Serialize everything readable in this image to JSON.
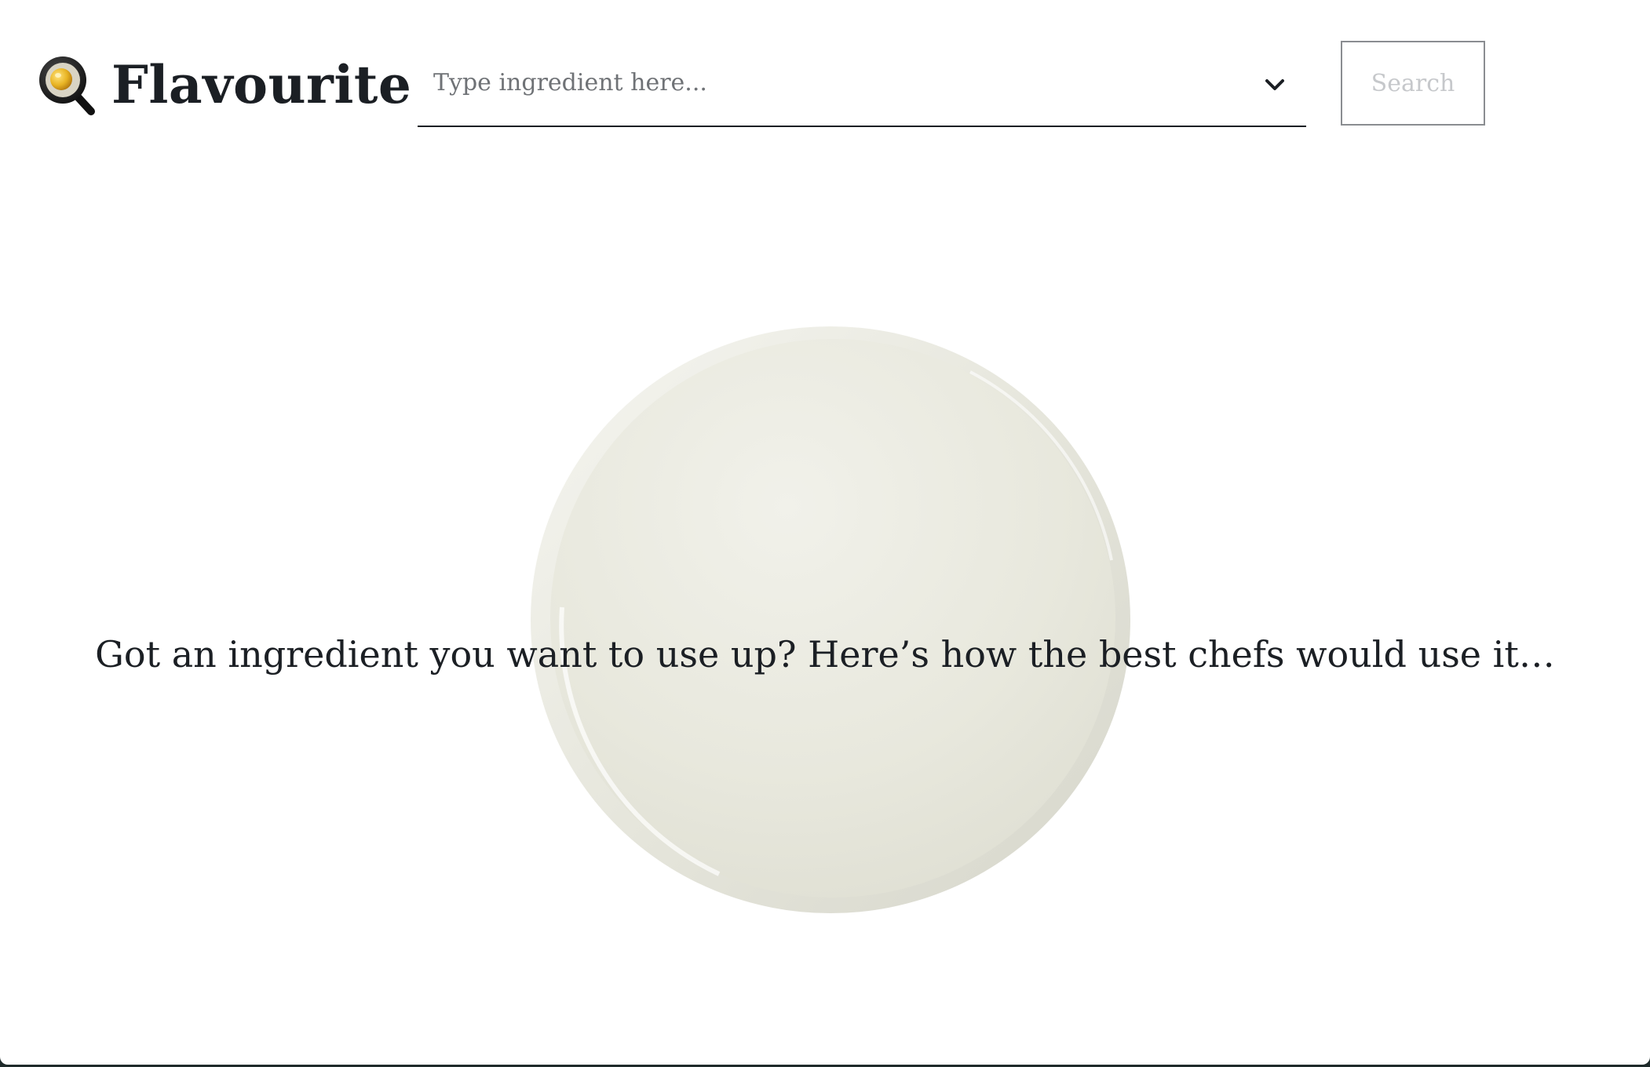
{
  "header": {
    "logo_icon": "frying-pan-egg-icon",
    "app_title": "Flavourite",
    "search": {
      "placeholder": "Type ingredient here...",
      "value": "",
      "dropdown_icon": "chevron-down-icon"
    },
    "search_button_label": "Search"
  },
  "main": {
    "background_image": "empty-plate",
    "tagline": "Got an ingredient you want to use up? Here’s how the best chefs would use it…"
  },
  "colors": {
    "text": "#1b1f24",
    "placeholder": "#6f7276",
    "button_disabled_text": "#c6c8cb",
    "button_border": "#8a8d91",
    "plate": "#ebebe1",
    "egg_yolk": "#e8b424"
  }
}
